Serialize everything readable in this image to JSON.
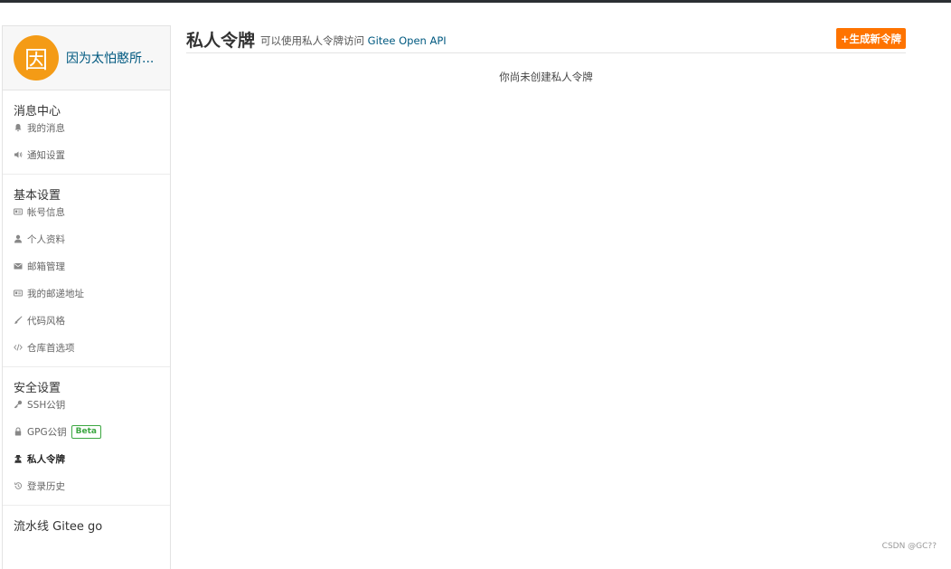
{
  "user": {
    "avatar_letter": "因",
    "name": "因为太怕憨所..."
  },
  "sidebar": {
    "sections": [
      {
        "title": "消息中心",
        "items": [
          {
            "label": "我的消息",
            "icon": "bell-icon"
          },
          {
            "label": "通知设置",
            "icon": "speaker-icon"
          }
        ]
      },
      {
        "title": "基本设置",
        "items": [
          {
            "label": "帐号信息",
            "icon": "id-card-icon"
          },
          {
            "label": "个人资料",
            "icon": "user-icon"
          },
          {
            "label": "邮箱管理",
            "icon": "envelope-icon"
          },
          {
            "label": "我的邮递地址",
            "icon": "address-card-icon"
          },
          {
            "label": "代码风格",
            "icon": "brush-icon"
          },
          {
            "label": "仓库首选项",
            "icon": "code-icon"
          }
        ]
      },
      {
        "title": "安全设置",
        "items": [
          {
            "label": "SSH公钥",
            "icon": "key-icon"
          },
          {
            "label": "GPG公钥",
            "icon": "lock-icon",
            "badge": "Beta"
          },
          {
            "label": "私人令牌",
            "icon": "user-secret-icon",
            "active": true
          },
          {
            "label": "登录历史",
            "icon": "history-icon"
          }
        ]
      },
      {
        "title": "流水线 Gitee go",
        "items": []
      }
    ]
  },
  "main": {
    "title": "私人令牌",
    "description_prefix": "可以使用私人令牌访问",
    "description_link": "Gitee Open API",
    "generate_button": "+生成新令牌",
    "empty_text": "你尚未创建私人令牌"
  },
  "watermark": "CSDN @GC??",
  "colors": {
    "accent": "#fe7300",
    "avatar": "#f49b16",
    "link": "#005980",
    "beta": "#3ca741"
  }
}
